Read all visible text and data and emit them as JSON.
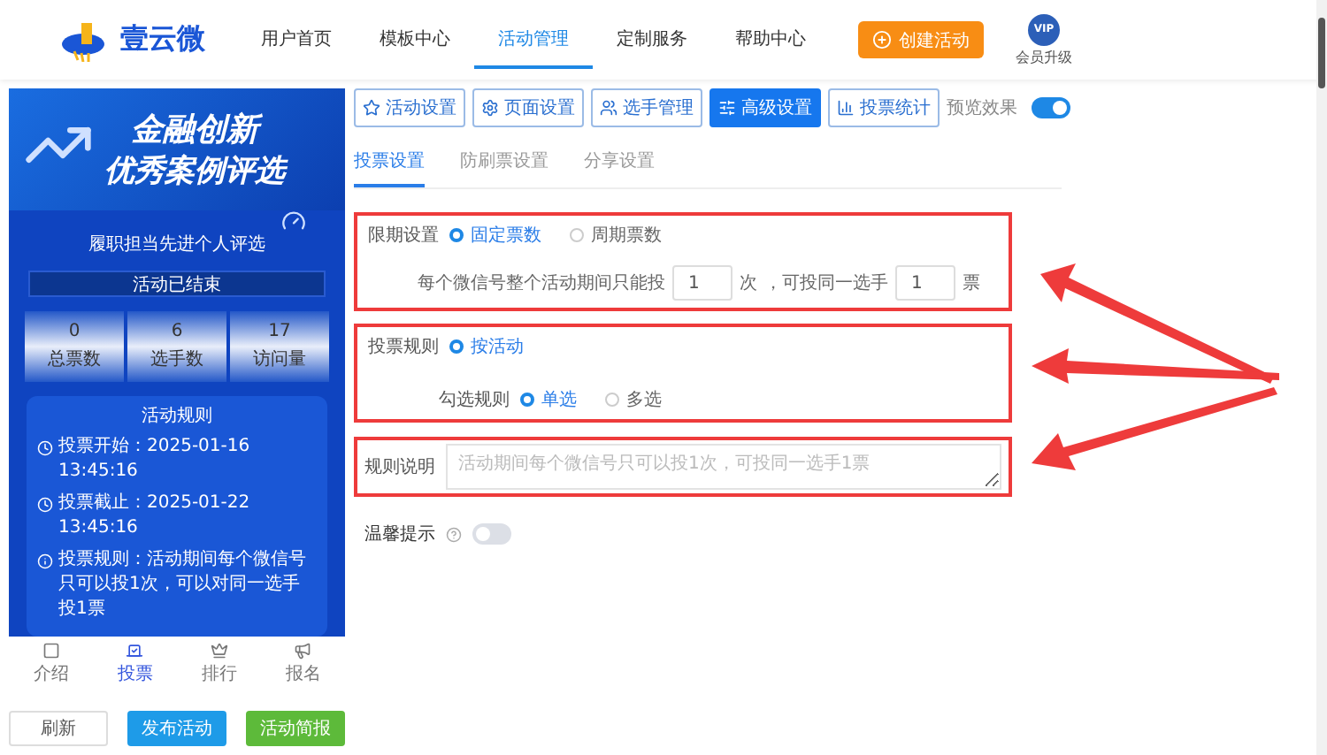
{
  "header": {
    "logo_text": "壹云微",
    "nav": [
      {
        "label": "用户首页",
        "selected": false
      },
      {
        "label": "模板中心",
        "selected": false
      },
      {
        "label": "活动管理",
        "selected": true
      },
      {
        "label": "定制服务",
        "selected": false
      },
      {
        "label": "帮助中心",
        "selected": false
      }
    ],
    "create_button": "创建活动",
    "vip_badge": "VIP",
    "vip_label": "会员升级"
  },
  "preview": {
    "banner_title": [
      "金融创新",
      "优秀案例评选"
    ],
    "activity_name": "履职担当先进个人评选",
    "status": "活动已结束",
    "stats": [
      {
        "value": "0",
        "label": "总票数"
      },
      {
        "value": "6",
        "label": "选手数"
      },
      {
        "value": "17",
        "label": "访问量"
      }
    ],
    "rules_title": "活动规则",
    "rules": [
      {
        "kind": "clock",
        "label": "投票开始：",
        "value": "2025-01-16 13:45:16"
      },
      {
        "kind": "clock",
        "label": "投票截止：",
        "value": "2025-01-22 13:45:16"
      },
      {
        "kind": "info",
        "label": "投票规则：",
        "value": "活动期间每个微信号只可以投1次，可以对同一选手投1票"
      }
    ],
    "tabbar": [
      {
        "kind": "intro",
        "label": "介绍",
        "selected": false
      },
      {
        "kind": "vote",
        "label": "投票",
        "selected": true
      },
      {
        "kind": "rank",
        "label": "排行",
        "selected": false
      },
      {
        "kind": "signup",
        "label": "报名",
        "selected": false
      }
    ]
  },
  "actions": [
    {
      "kind": "default",
      "label": "刷新"
    },
    {
      "kind": "primary",
      "label": "发布活动"
    },
    {
      "kind": "success",
      "label": "活动简报"
    }
  ],
  "toolbar": {
    "buttons": [
      {
        "kind": "star",
        "label": "活动设置",
        "selected": false
      },
      {
        "kind": "gear",
        "label": "页面设置",
        "selected": false
      },
      {
        "kind": "users",
        "label": "选手管理",
        "selected": false
      },
      {
        "kind": "sliders",
        "label": "高级设置",
        "selected": true
      },
      {
        "kind": "chart",
        "label": "投票统计",
        "selected": false
      }
    ],
    "preview_label": "预览效果",
    "preview_on": true
  },
  "subtabs": [
    {
      "label": "投票设置",
      "selected": true
    },
    {
      "label": "防刷票设置",
      "selected": false
    },
    {
      "label": "分享设置",
      "selected": false
    }
  ],
  "limit": {
    "label": "限期设置",
    "options": [
      {
        "label": "固定票数",
        "selected": true
      },
      {
        "label": "周期票数",
        "selected": false
      }
    ],
    "prefix": "每个微信号整个活动期间只能投",
    "times_value": "1",
    "times_unit": "次",
    "middle": "，可投同一选手",
    "votes_value": "1",
    "votes_unit": "票"
  },
  "rule": {
    "label": "投票规则",
    "options": [
      {
        "label": "按活动",
        "selected": true
      }
    ],
    "check_label": "勾选规则",
    "check_options": [
      {
        "label": "单选",
        "selected": true
      },
      {
        "label": "多选",
        "selected": false
      }
    ]
  },
  "description": {
    "label": "规则说明",
    "placeholder": "活动期间每个微信号只可以投1次，可投同一选手1票"
  },
  "tip": {
    "label": "温馨提示",
    "on": false
  }
}
